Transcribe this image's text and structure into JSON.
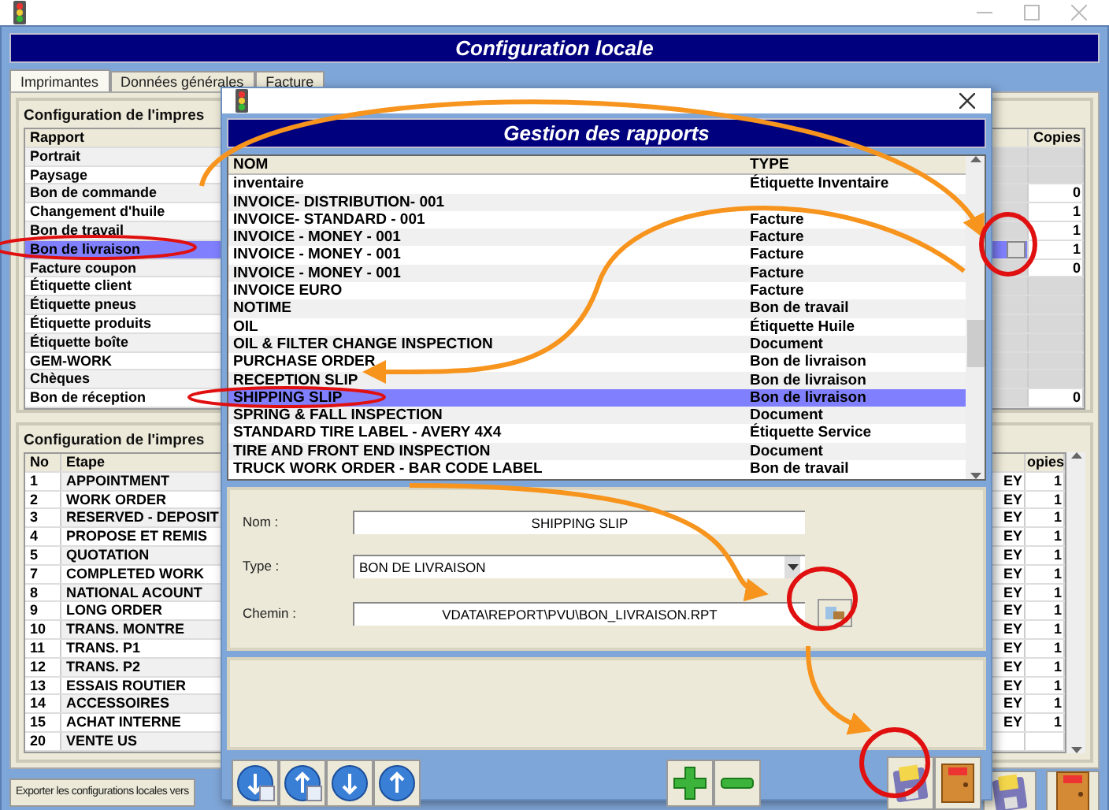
{
  "main_window": {
    "title": "Configuration locale",
    "tabs": [
      {
        "label": "Imprimantes",
        "selected": true
      },
      {
        "label": "Données générales",
        "selected": false
      },
      {
        "label": "Facture",
        "selected": false
      }
    ],
    "report_panel": {
      "title": "Configuration de l'impres",
      "columns": [
        "Rapport",
        "Copies"
      ],
      "rows": [
        {
          "name": "Portrait",
          "selected": false
        },
        {
          "name": "Paysage",
          "selected": false
        },
        {
          "name": "Bon de commande",
          "copies": "0",
          "selected": false
        },
        {
          "name": "Changement d'huile",
          "copies": "1",
          "selected": false
        },
        {
          "name": "Bon de travail",
          "copies": "1",
          "selected": false
        },
        {
          "name": "Bon de livraison",
          "copies": "1",
          "selected": true
        },
        {
          "name": "Facture coupon",
          "copies": "0",
          "selected": false
        },
        {
          "name": "Étiquette client",
          "selected": false
        },
        {
          "name": "Étiquette pneus",
          "selected": false
        },
        {
          "name": "Étiquette produits",
          "selected": false
        },
        {
          "name": "Étiquette boîte",
          "selected": false
        },
        {
          "name": "GEM-WORK",
          "selected": false
        },
        {
          "name": "Chèques",
          "selected": false
        },
        {
          "name": "Bon de réception",
          "copies": "0",
          "selected": false
        }
      ]
    },
    "step_panel": {
      "title": "Configuration de l'impres",
      "columns": [
        "No",
        "Etape",
        "opies"
      ],
      "rows": [
        {
          "no": "1",
          "step": "APPOINTMENT",
          "column_3": "EY",
          "copies": "1"
        },
        {
          "no": "2",
          "step": "WORK ORDER",
          "column_3": "EY",
          "copies": "1"
        },
        {
          "no": "3",
          "step": "RESERVED - DEPOSIT",
          "column_3": "EY",
          "copies": "1"
        },
        {
          "no": "4",
          "step": "PROPOSE ET REMIS",
          "column_3": "EY",
          "copies": "1"
        },
        {
          "no": "5",
          "step": "QUOTATION",
          "column_3": "EY",
          "copies": "1"
        },
        {
          "no": "7",
          "step": "COMPLETED WORK",
          "column_3": "EY",
          "copies": "1"
        },
        {
          "no": "8",
          "step": "NATIONAL ACOUNT",
          "column_3": "EY",
          "copies": "1"
        },
        {
          "no": "9",
          "step": "LONG ORDER",
          "column_3": "EY",
          "copies": "1"
        },
        {
          "no": "10",
          "step": "TRANS. MONTRE",
          "column_3": "EY",
          "copies": "1"
        },
        {
          "no": "11",
          "step": "TRANS. P1",
          "column_3": "EY",
          "copies": "1"
        },
        {
          "no": "12",
          "step": "TRANS. P2",
          "column_3": "EY",
          "copies": "1"
        },
        {
          "no": "13",
          "step": "ESSAIS ROUTIER",
          "column_3": "EY",
          "copies": "1"
        },
        {
          "no": "14",
          "step": "ACCESSOIRES",
          "column_3": "EY",
          "copies": "1"
        },
        {
          "no": "15",
          "step": "ACHAT INTERNE",
          "column_3": "EY",
          "copies": "1"
        },
        {
          "no": "20",
          "step": "VENTE US"
        }
      ]
    },
    "export_button": "Exporter les configurations locales vers"
  },
  "dialog": {
    "title": "Gestion des rapports",
    "columns": [
      "NOM",
      "TYPE"
    ],
    "rows": [
      {
        "name": "inventaire",
        "type": "Étiquette Inventaire",
        "selected": false
      },
      {
        "name": "INVOICE- DISTRIBUTION- 001",
        "selected": false
      },
      {
        "name": "INVOICE- STANDARD - 001",
        "type": "Facture",
        "selected": false
      },
      {
        "name": "INVOICE - MONEY - 001",
        "type": "Facture",
        "selected": false
      },
      {
        "name": "INVOICE - MONEY - 001",
        "type": "Facture",
        "selected": false
      },
      {
        "name": "INVOICE - MONEY - 001",
        "type": "Facture",
        "selected": false
      },
      {
        "name": "INVOICE EURO",
        "type": "Facture",
        "selected": false
      },
      {
        "name": "NOTIME",
        "type": "Bon de travail",
        "selected": false
      },
      {
        "name": "OIL",
        "type": "Étiquette Huile",
        "selected": false
      },
      {
        "name": "OIL & FILTER CHANGE INSPECTION",
        "type": "Document",
        "selected": false
      },
      {
        "name": "PURCHASE ORDER",
        "type": "Bon de livraison",
        "selected": false
      },
      {
        "name": "RECEPTION SLIP",
        "type": "Bon de livraison",
        "selected": false
      },
      {
        "name": "SHIPPING SLIP",
        "type": "Bon de livraison",
        "selected": true
      },
      {
        "name": "SPRING & FALL INSPECTION",
        "type": "Document",
        "selected": false
      },
      {
        "name": "STANDARD TIRE LABEL - AVERY 4X4",
        "type": "Étiquette Service",
        "selected": false
      },
      {
        "name": "TIRE AND FRONT END INSPECTION",
        "type": "Document",
        "selected": false
      },
      {
        "name": "TRUCK WORK ORDER - BAR CODE LABEL",
        "type": "Bon de travail",
        "selected": false
      }
    ],
    "form": {
      "name_label": "Nom :",
      "name_value": "SHIPPING SLIP",
      "type_label": "Type :",
      "type_value": "BON DE LIVRAISON",
      "path_label": "Chemin :",
      "path_value": "VDATA\\REPORT\\PVU\\BON_LIVRAISON.RPT"
    }
  }
}
